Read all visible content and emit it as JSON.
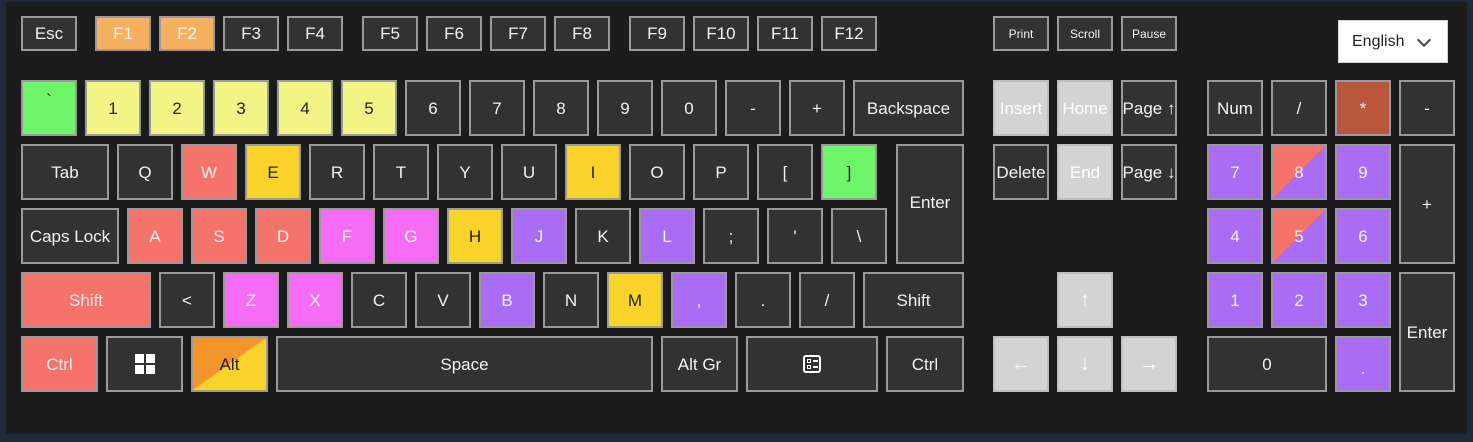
{
  "colors": {
    "key_default": "#323232",
    "orange": "#f5b060",
    "yellow_light": "#f2f585",
    "green": "#6ef56a",
    "salmon": "#f5736a",
    "gold": "#fad32a",
    "magenta": "#f66cf5",
    "purple": "#a86cf5",
    "rust": "#b8573e",
    "alt_orange": "#f2952a",
    "light_gray": "#d3d3d3"
  },
  "language": {
    "selected": "English"
  },
  "keys": {
    "esc": "Esc",
    "f1": "F1",
    "f2": "F2",
    "f3": "F3",
    "f4": "F4",
    "f5": "F5",
    "f6": "F6",
    "f7": "F7",
    "f8": "F8",
    "f9": "F9",
    "f10": "F10",
    "f11": "F11",
    "f12": "F12",
    "print": "Print",
    "scroll": "Scroll",
    "pause": "Pause",
    "backtick": "`",
    "d1": "1",
    "d2": "2",
    "d3": "3",
    "d4": "4",
    "d5": "5",
    "d6": "6",
    "d7": "7",
    "d8": "8",
    "d9": "9",
    "d0": "0",
    "minus": "-",
    "plus": "+",
    "backspace": "Backspace",
    "tab": "Tab",
    "q": "Q",
    "w": "W",
    "e": "E",
    "r": "R",
    "t": "T",
    "y": "Y",
    "u": "U",
    "i": "I",
    "o": "O",
    "p": "P",
    "lbracket": "[",
    "rbracket": "]",
    "enter": "Enter",
    "capslock": "Caps Lock",
    "a": "A",
    "s": "S",
    "d": "D",
    "f": "F",
    "g": "G",
    "h": "H",
    "j": "J",
    "k": "K",
    "l": "L",
    "semicolon": ";",
    "quote": "'",
    "backslash": "\\",
    "lshift": "Shift",
    "lt": "<",
    "z": "Z",
    "x": "X",
    "c": "C",
    "v": "V",
    "b": "B",
    "n": "N",
    "m": "M",
    "comma": ",",
    "period": ".",
    "slash": "/",
    "rshift": "Shift",
    "lctrl": "Ctrl",
    "alt": "Alt",
    "space": "Space",
    "altgr": "Alt Gr",
    "rctrl": "Ctrl",
    "insert": "Insert",
    "home": "Home",
    "pageup": "Page ↑",
    "delete": "Delete",
    "end": "End",
    "pagedown": "Page ↓",
    "up": "↑",
    "left": "←",
    "down": "↓",
    "right": "→",
    "num": "Num",
    "num_div": "/",
    "num_mul": "*",
    "num_sub": "-",
    "num7": "7",
    "num8": "8",
    "num9": "9",
    "num_add": "+",
    "num4": "4",
    "num5": "5",
    "num6": "6",
    "num1": "1",
    "num2": "2",
    "num3": "3",
    "num_enter": "Enter",
    "num0": "0",
    "num_dot": "."
  }
}
